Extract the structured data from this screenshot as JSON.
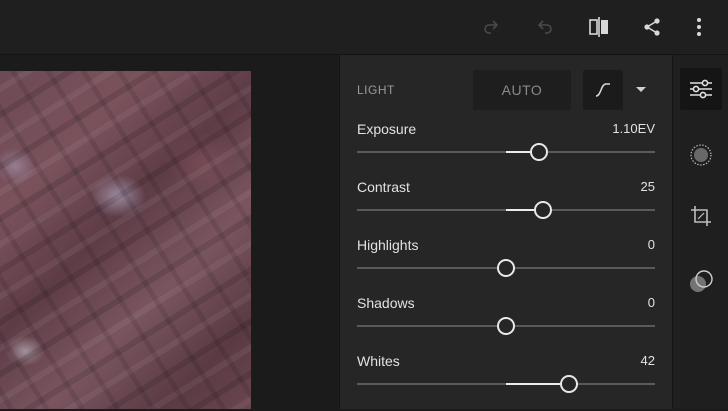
{
  "toolbar": {
    "icons": [
      "redo-icon",
      "undo-icon",
      "compare-icon",
      "share-icon",
      "more-icon"
    ]
  },
  "panel": {
    "section_title": "LIGHT",
    "auto_label": "AUTO",
    "sliders": [
      {
        "label": "Exposure",
        "value": "1.10EV",
        "position": 0.61
      },
      {
        "label": "Contrast",
        "value": "25",
        "position": 0.625
      },
      {
        "label": "Highlights",
        "value": "0",
        "position": 0.5
      },
      {
        "label": "Shadows",
        "value": "0",
        "position": 0.5
      },
      {
        "label": "Whites",
        "value": "42",
        "position": 0.71
      }
    ]
  },
  "rail": {
    "icons": [
      "edit-sliders-icon",
      "selective-brush-icon",
      "crop-icon",
      "presets-icon"
    ],
    "active": "edit-sliders-icon"
  },
  "colors": {
    "panel_bg": "#262626",
    "rail_bg": "#1f1f1f",
    "accent": "#ececec"
  }
}
